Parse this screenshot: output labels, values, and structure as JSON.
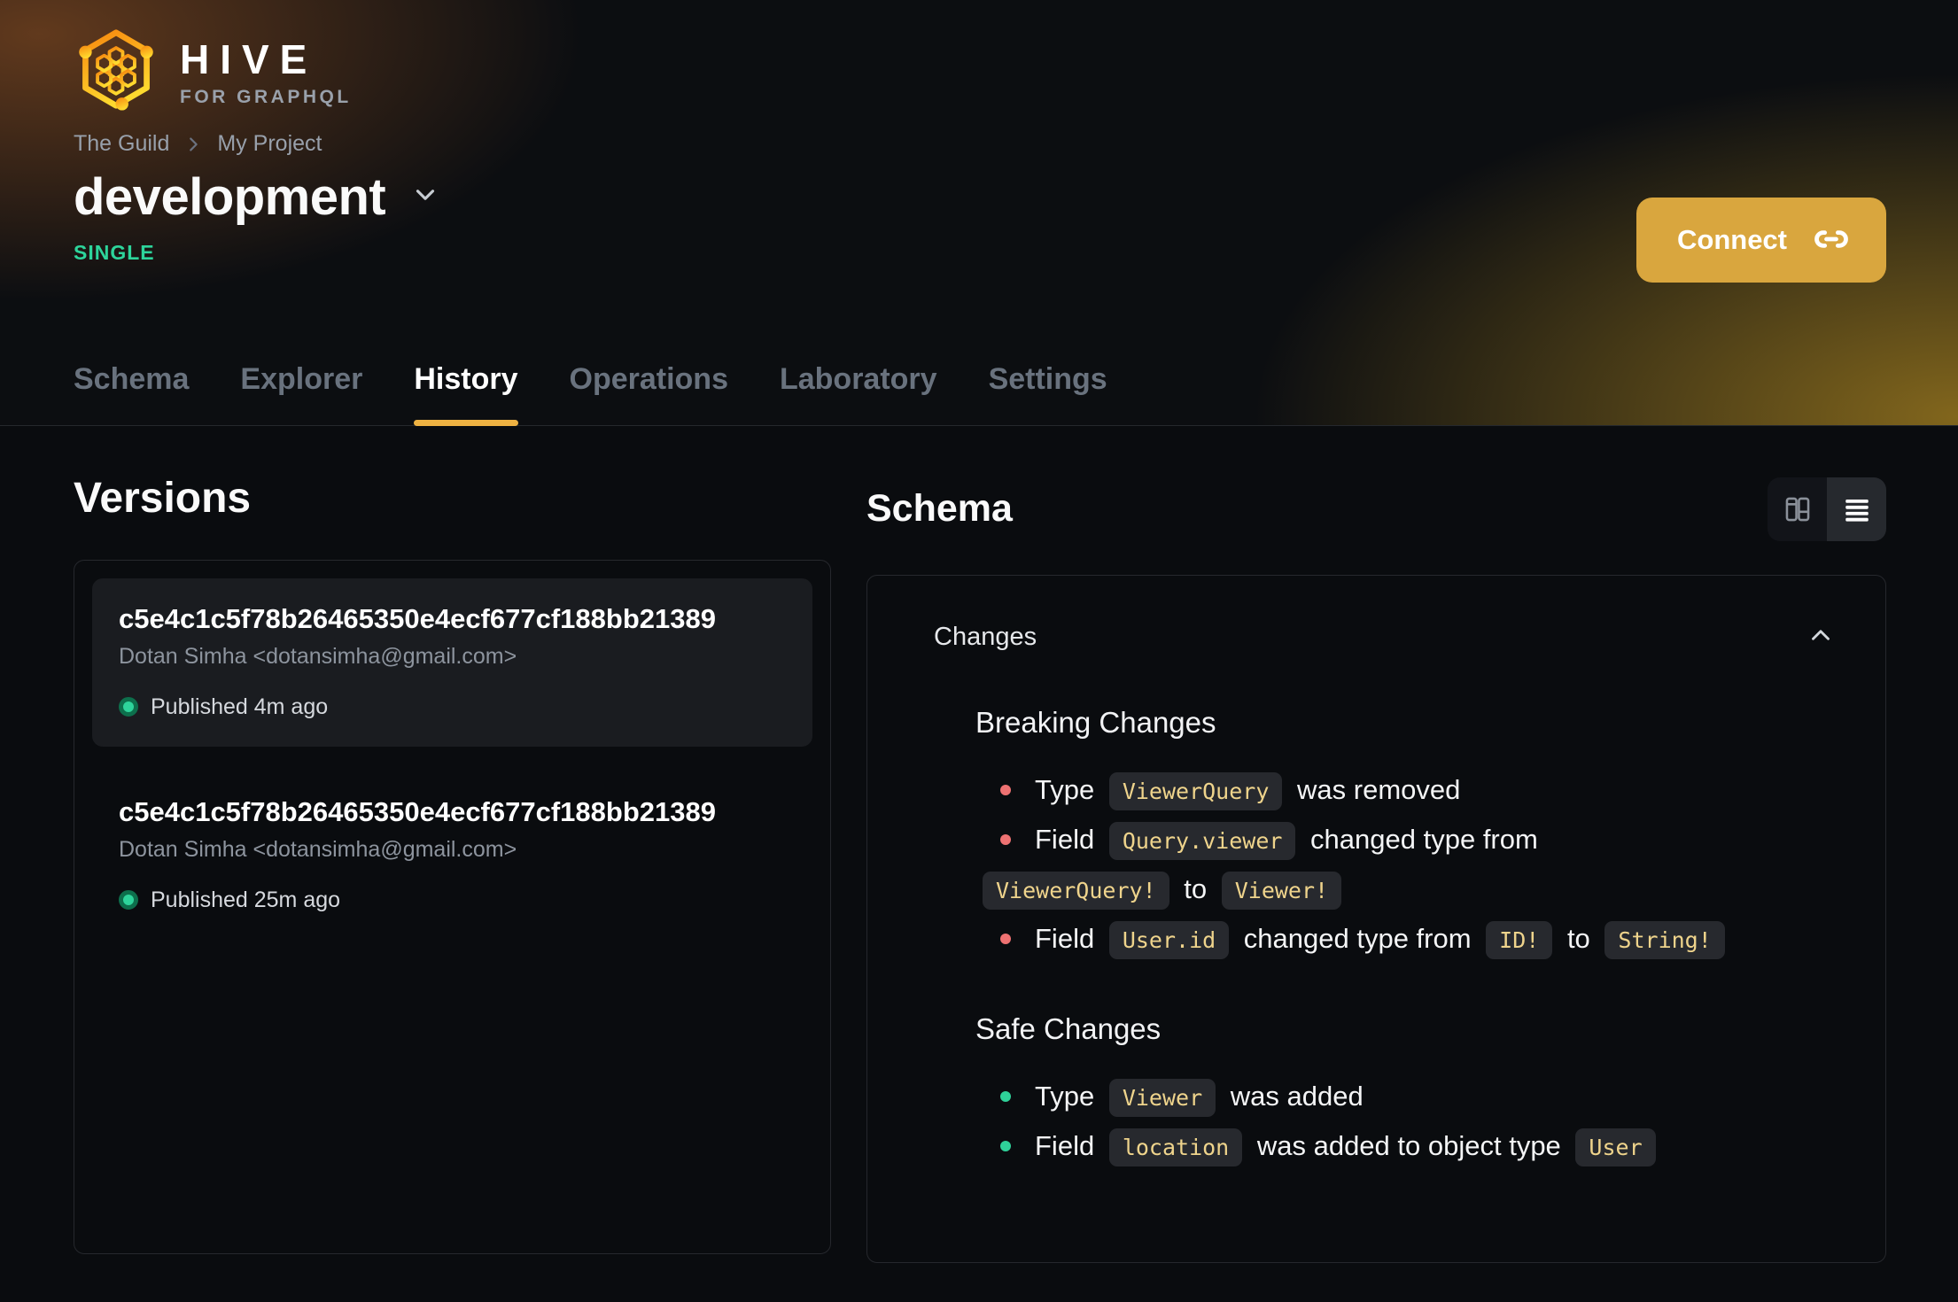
{
  "brand": {
    "title": "HIVE",
    "subtitle": "FOR GRAPHQL"
  },
  "breadcrumb": {
    "org": "The Guild",
    "project": "My Project"
  },
  "target": {
    "name": "development",
    "type_badge": "SINGLE"
  },
  "connect": {
    "label": "Connect"
  },
  "tabs": [
    {
      "label": "Schema",
      "active": false
    },
    {
      "label": "Explorer",
      "active": false
    },
    {
      "label": "History",
      "active": true
    },
    {
      "label": "Operations",
      "active": false
    },
    {
      "label": "Laboratory",
      "active": false
    },
    {
      "label": "Settings",
      "active": false
    }
  ],
  "versions": {
    "heading": "Versions",
    "items": [
      {
        "hash": "c5e4c1c5f78b26465350e4ecf677cf188bb21389",
        "author": "Dotan Simha <dotansimha@gmail.com>",
        "status": "Published 4m ago",
        "selected": true
      },
      {
        "hash": "c5e4c1c5f78b26465350e4ecf677cf188bb21389",
        "author": "Dotan Simha <dotansimha@gmail.com>",
        "status": "Published 25m ago",
        "selected": false
      }
    ]
  },
  "schema_panel": {
    "heading": "Schema",
    "changes_label": "Changes",
    "breaking": {
      "heading": "Breaking Changes",
      "items": [
        {
          "parts": [
            {
              "text": "Type "
            },
            {
              "code": "ViewerQuery"
            },
            {
              "text": " was removed"
            }
          ]
        },
        {
          "parts": [
            {
              "text": "Field "
            },
            {
              "code": "Query.viewer"
            },
            {
              "text": " changed type from "
            },
            {
              "code": "ViewerQuery!"
            },
            {
              "text": " to "
            },
            {
              "code": "Viewer!"
            }
          ]
        },
        {
          "parts": [
            {
              "text": "Field "
            },
            {
              "code": "User.id"
            },
            {
              "text": " changed type from "
            },
            {
              "code": "ID!"
            },
            {
              "text": " to "
            },
            {
              "code": "String!"
            }
          ]
        }
      ]
    },
    "safe": {
      "heading": "Safe Changes",
      "items": [
        {
          "parts": [
            {
              "text": "Type "
            },
            {
              "code": "Viewer"
            },
            {
              "text": " was added"
            }
          ]
        },
        {
          "parts": [
            {
              "text": "Field "
            },
            {
              "code": "location"
            },
            {
              "text": " was added to object type "
            },
            {
              "code": "User"
            }
          ]
        }
      ]
    }
  },
  "icons": {
    "logo": "hive-honeycomb-logo",
    "breadcrumb_separator": "chevron-right",
    "target_dropdown": "chevron-down",
    "connect_button": "link",
    "view_toggle_left": "split-columns",
    "view_toggle_right": "list-lines",
    "changes_collapse": "chevron-up",
    "published_status": "green-status-dot"
  },
  "colors": {
    "accent_button": "#d9a63e",
    "tab_underline": "#eeb242",
    "badge_green": "#2dd49b",
    "breaking_bullet": "#ee7272",
    "safe_bullet": "#2fd199",
    "code_text": "#efd48c",
    "code_bg": "#27292e",
    "panel_border": "#26282d",
    "selected_card_bg": "#1a1c20"
  }
}
